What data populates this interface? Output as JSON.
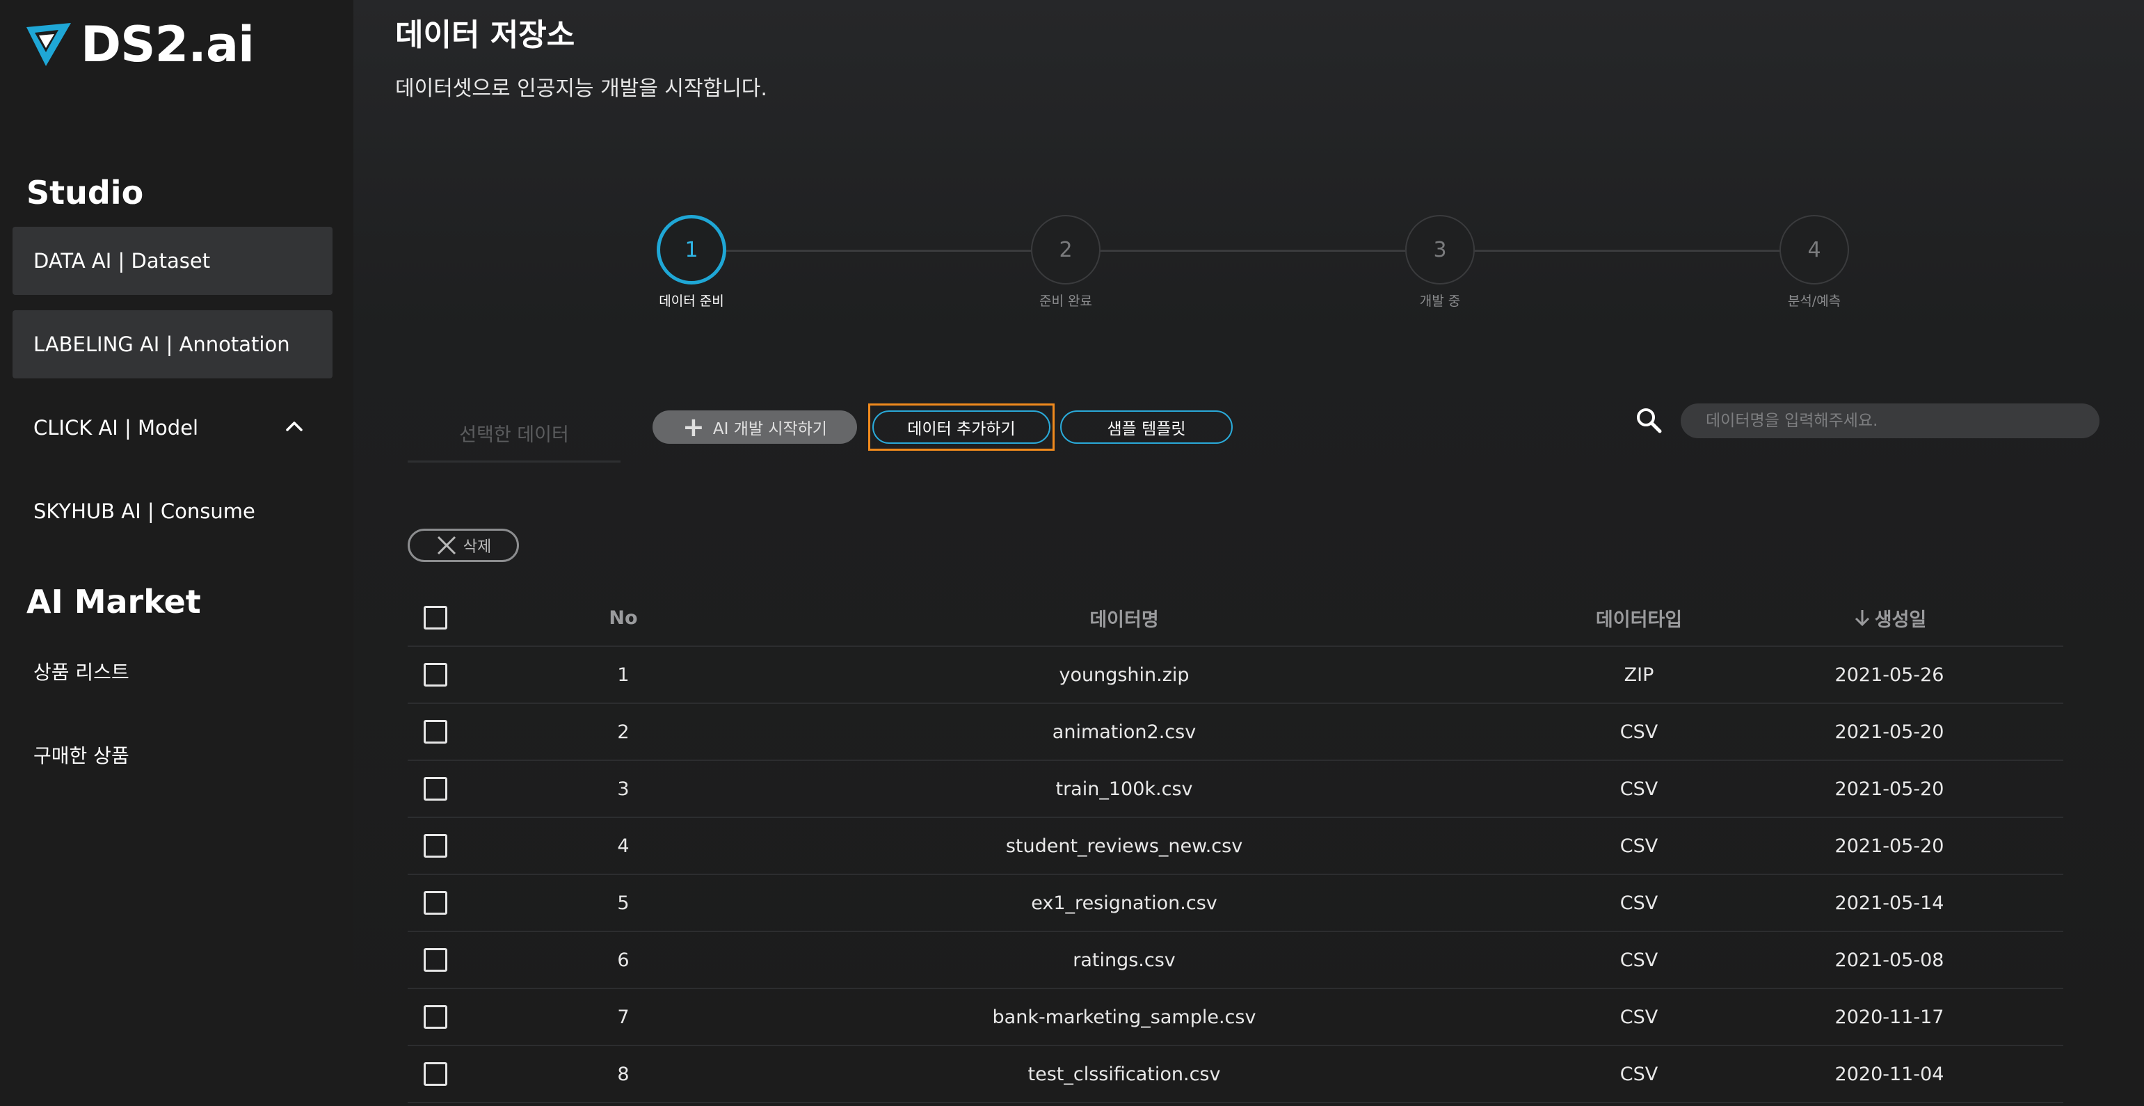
{
  "brand": {
    "name": "DS2.ai",
    "accent": "#1fa7d6"
  },
  "sidebar": {
    "studio_title": "Studio",
    "studio_items": [
      {
        "label": "DATA AI | Dataset"
      },
      {
        "label": "LABELING AI | Annotation"
      },
      {
        "label": "CLICK AI | Model"
      },
      {
        "label": "SKYHUB AI | Consume"
      }
    ],
    "market_title": "AI Market",
    "market_items": [
      {
        "label": "상품 리스트"
      },
      {
        "label": "구매한 상품"
      }
    ]
  },
  "page": {
    "title": "데이터 저장소",
    "subtitle": "데이터셋으로 인공지능 개발을 시작합니다."
  },
  "stepper": [
    {
      "number": "1",
      "label": "데이터 준비",
      "active": true
    },
    {
      "number": "2",
      "label": "준비 완료",
      "active": false
    },
    {
      "number": "3",
      "label": "개발 중",
      "active": false
    },
    {
      "number": "4",
      "label": "분석/예측",
      "active": false
    }
  ],
  "toolbar": {
    "selected_tab": "선택한 데이터",
    "ai_start": "AI 개발 시작하기",
    "add_data": "데이터 추가하기",
    "sample_template": "샘플 템플릿",
    "search_placeholder": "데이터명을 입력해주세요.",
    "delete": "삭제"
  },
  "table": {
    "headers": {
      "no": "No",
      "name": "데이터명",
      "type": "데이터타입",
      "date": "생성일"
    },
    "rows": [
      {
        "no": "1",
        "name": "youngshin.zip",
        "type": "ZIP",
        "date": "2021-05-26"
      },
      {
        "no": "2",
        "name": "animation2.csv",
        "type": "CSV",
        "date": "2021-05-20"
      },
      {
        "no": "3",
        "name": "train_100k.csv",
        "type": "CSV",
        "date": "2021-05-20"
      },
      {
        "no": "4",
        "name": "student_reviews_new.csv",
        "type": "CSV",
        "date": "2021-05-20"
      },
      {
        "no": "5",
        "name": "ex1_resignation.csv",
        "type": "CSV",
        "date": "2021-05-14"
      },
      {
        "no": "6",
        "name": "ratings.csv",
        "type": "CSV",
        "date": "2021-05-08"
      },
      {
        "no": "7",
        "name": "bank-marketing_sample.csv",
        "type": "CSV",
        "date": "2020-11-17"
      },
      {
        "no": "8",
        "name": "test_clssification.csv",
        "type": "CSV",
        "date": "2020-11-04"
      }
    ]
  }
}
